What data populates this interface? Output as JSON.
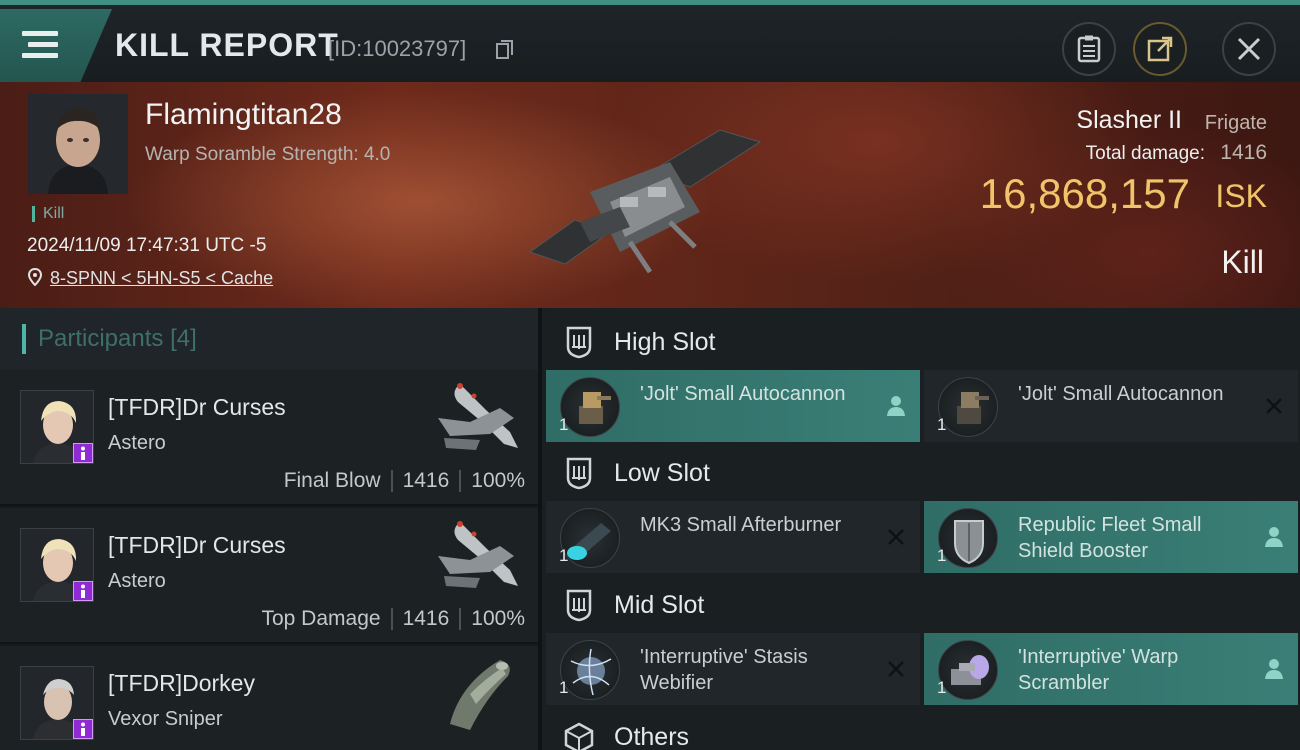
{
  "header": {
    "title": "KILL REPORT",
    "report_id": "[ID:10023797]"
  },
  "victim": {
    "name": "Flamingtitan28",
    "scram_strength": "Warp Soramble Strength: 4.0",
    "kill_tag": "Kill",
    "timestamp": "2024/11/09 17:47:31 UTC -5",
    "location": "8-SPNN < 5HN-S5 < Cache",
    "ship_name": "Slasher II",
    "ship_class": "Frigate",
    "total_damage_label": "Total damage:",
    "total_damage": "1416",
    "isk_value": "16,868,157",
    "isk_unit": "ISK",
    "outcome": "Kill"
  },
  "participants": {
    "title": "Participants",
    "count": "[4]",
    "items": [
      {
        "name": "[TFDR]Dr Curses",
        "ship": "Astero",
        "role": "Final Blow",
        "damage": "1416",
        "percent": "100%"
      },
      {
        "name": "[TFDR]Dr Curses",
        "ship": "Astero",
        "role": "Top Damage",
        "damage": "1416",
        "percent": "100%"
      },
      {
        "name": "[TFDR]Dorkey",
        "ship": "Vexor Sniper"
      }
    ]
  },
  "fitting": {
    "high_slot": {
      "title": "High Slot",
      "modules": [
        {
          "name": "'Jolt' Small Autocannon",
          "qty": "1",
          "status": "dropped"
        },
        {
          "name": "'Jolt' Small Autocannon",
          "qty": "1",
          "status": "destroyed"
        }
      ]
    },
    "low_slot": {
      "title": "Low Slot",
      "modules": [
        {
          "name": "MK3 Small Afterburner",
          "qty": "1",
          "status": "destroyed"
        },
        {
          "name": "Republic Fleet Small Shield Booster",
          "qty": "1",
          "status": "dropped"
        }
      ]
    },
    "mid_slot": {
      "title": "Mid Slot",
      "modules": [
        {
          "name": "'Interruptive' Stasis Webifier",
          "qty": "1",
          "status": "destroyed"
        },
        {
          "name": "'Interruptive' Warp Scrambler",
          "qty": "1",
          "status": "dropped"
        }
      ]
    },
    "others": {
      "title": "Others"
    }
  },
  "icons": {
    "menu": "menu-icon",
    "copy": "copy-icon",
    "clipboard": "clipboard-icon",
    "share": "share-icon",
    "close": "close-icon",
    "location": "location-pin-icon",
    "slot": "slot-icon",
    "cube": "cube-icon",
    "pilot": "pilot-icon",
    "destroyed": "x-icon"
  },
  "colors": {
    "accent": "#3f8f83",
    "isk": "#f0c56a",
    "dropped_bg": "#357870",
    "badge": "#8f2ad4"
  }
}
